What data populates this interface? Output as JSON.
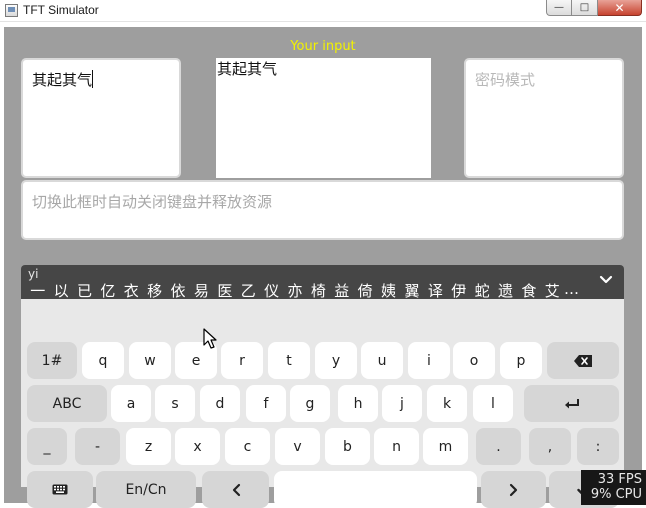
{
  "window": {
    "title": "TFT Simulator",
    "min_label": "—",
    "max_label": "□",
    "close_label": "✕"
  },
  "screen": {
    "your_input_label": "Your input",
    "textarea_1_text": "其起其气",
    "textarea_2_text": "其起其气",
    "password_placeholder": "密码模式",
    "textarea_4_placeholder": "切换此框时自动关闭键盘并释放资源"
  },
  "candidates": {
    "pinyin": "yi",
    "items": [
      "一",
      "以",
      "已",
      "亿",
      "衣",
      "移",
      "依",
      "易",
      "医",
      "乙",
      "仪",
      "亦",
      "椅",
      "益",
      "倚",
      "姨",
      "翼",
      "译",
      "伊",
      "蛇",
      "遗",
      "食",
      "艾"
    ],
    "overflow_hint": "…"
  },
  "keyboard": {
    "row1": [
      {
        "label": "1#",
        "name": "key-symbols",
        "fn": true
      },
      {
        "label": "q",
        "name": "key-q"
      },
      {
        "label": "w",
        "name": "key-w"
      },
      {
        "label": "e",
        "name": "key-e"
      },
      {
        "label": "r",
        "name": "key-r"
      },
      {
        "label": "t",
        "name": "key-t"
      },
      {
        "label": "y",
        "name": "key-y"
      },
      {
        "label": "u",
        "name": "key-u"
      },
      {
        "label": "i",
        "name": "key-i"
      },
      {
        "label": "o",
        "name": "key-o"
      },
      {
        "label": "p",
        "name": "key-p"
      },
      {
        "label": "",
        "name": "backspace-key",
        "fn": true,
        "icon": "backspace-icon"
      }
    ],
    "row2": [
      {
        "label": "ABC",
        "name": "key-abc",
        "fn": true
      },
      {
        "label": "a",
        "name": "key-a"
      },
      {
        "label": "s",
        "name": "key-s"
      },
      {
        "label": "d",
        "name": "key-d"
      },
      {
        "label": "f",
        "name": "key-f"
      },
      {
        "label": "g",
        "name": "key-g"
      },
      {
        "label": "h",
        "name": "key-h"
      },
      {
        "label": "j",
        "name": "key-j"
      },
      {
        "label": "k",
        "name": "key-k"
      },
      {
        "label": "l",
        "name": "key-l"
      },
      {
        "label": "",
        "name": "enter-key",
        "fn": true,
        "icon": "enter-icon"
      }
    ],
    "row3": [
      {
        "label": "_",
        "name": "key-underscore",
        "fn": true
      },
      {
        "label": "-",
        "name": "key-dash",
        "fn": true
      },
      {
        "label": "z",
        "name": "key-z"
      },
      {
        "label": "x",
        "name": "key-x"
      },
      {
        "label": "c",
        "name": "key-c"
      },
      {
        "label": "v",
        "name": "key-v"
      },
      {
        "label": "b",
        "name": "key-b"
      },
      {
        "label": "n",
        "name": "key-n"
      },
      {
        "label": "m",
        "name": "key-m"
      },
      {
        "label": ".",
        "name": "key-period",
        "fn": true
      },
      {
        "label": ",",
        "name": "key-comma",
        "fn": true
      },
      {
        "label": ":",
        "name": "key-colon",
        "fn": true
      }
    ],
    "row4": [
      {
        "label": "",
        "name": "keyboard-toggle-key",
        "fn": true,
        "icon": "keyboard-icon"
      },
      {
        "label": "En/Cn",
        "name": "key-lang-switch",
        "fn": true
      },
      {
        "label": "",
        "name": "key-left",
        "fn": true,
        "icon": "chevron-left-icon"
      },
      {
        "label": "",
        "name": "key-space"
      },
      {
        "label": "",
        "name": "key-right",
        "fn": true,
        "icon": "chevron-right-icon"
      },
      {
        "label": "",
        "name": "key-ok",
        "fn": true,
        "icon": "check-icon"
      }
    ]
  },
  "perf": {
    "fps": "33 FPS",
    "cpu": "9% CPU"
  },
  "colors": {
    "screen_bg": "#9e9e9e",
    "label_yellow": "#f2f200",
    "candidate_bar": "#464646",
    "keyboard_bg": "#e8e8e8"
  }
}
